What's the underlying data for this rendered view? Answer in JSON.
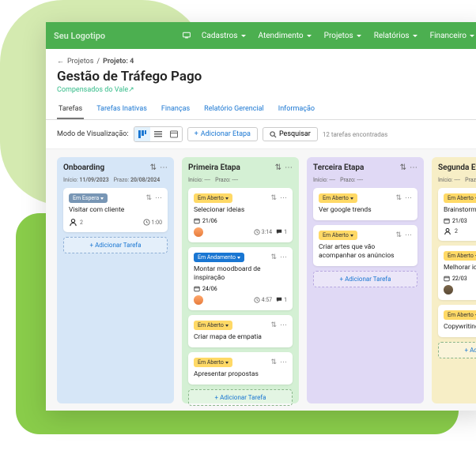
{
  "brand": {
    "logo": "Seu Logotipo"
  },
  "nav": {
    "items": [
      "Cadastros",
      "Atendimento",
      "Projetos",
      "Relatórios",
      "Financeiro"
    ]
  },
  "breadcrumb": {
    "back_icon": "←",
    "parent": "Projetos",
    "sep": "/",
    "current": "Projeto: 4"
  },
  "page": {
    "title": "Gestão de Tráfego Pago",
    "subtitle": "Compensados do Vale↗"
  },
  "tabs": [
    "Tarefas",
    "Tarefas Inativas",
    "Finanças",
    "Relatório Gerencial",
    "Informação"
  ],
  "toolbar": {
    "view_label": "Modo de Visualização:",
    "add_stage": "Adicionar Etapa",
    "search": "Pesquisar",
    "count": "12 tarefas encontradas"
  },
  "columns": [
    {
      "title": "Onboarding",
      "start_label": "Início:",
      "start": "11/09/2023",
      "end_label": "Prazo:",
      "end": "20/08/2024",
      "color": "blue",
      "cards": [
        {
          "status": "Em Espera",
          "status_kind": "espera",
          "title": "Visitar com cliente",
          "people": "2",
          "time": "1:00"
        }
      ],
      "add_label": "Adicionar Tarefa"
    },
    {
      "title": "Primeira Etapa",
      "start_label": "Início:",
      "start": "----",
      "end_label": "Prazo:",
      "end": "----",
      "color": "green",
      "cards": [
        {
          "status": "Em Aberto",
          "status_kind": "aberto",
          "title": "Selecionar ideias",
          "date": "21/06",
          "avatar": "u1",
          "time": "3:14",
          "comments": "1"
        },
        {
          "status": "Em Andamento",
          "status_kind": "andamento",
          "title": "Montar moodboard de inspiração",
          "date": "24/06",
          "avatar": "u1",
          "time": "4:57",
          "comments": "1"
        },
        {
          "status": "Em Aberto",
          "status_kind": "aberto",
          "title": "Criar mapa de empatia"
        },
        {
          "status": "Em Aberto",
          "status_kind": "aberto",
          "title": "Apresentar propostas"
        }
      ],
      "add_label": "Adicionar Tarefa"
    },
    {
      "title": "Terceira Etapa",
      "start_label": "Início:",
      "start": "----",
      "end_label": "Prazo:",
      "end": "----",
      "color": "purple",
      "cards": [
        {
          "status": "Em Aberto",
          "status_kind": "aberto",
          "title": "Ver google trends"
        },
        {
          "status": "Em Aberto",
          "status_kind": "aberto",
          "title": "Criar artes que vão acompanhar os anúncios"
        }
      ],
      "add_label": "Adicionar Tarefa"
    },
    {
      "title": "Segunda Etapa",
      "start_label": "Início:",
      "start": "----",
      "end_label": "Prazo:",
      "end": "----",
      "color": "yellow",
      "cards": [
        {
          "status": "Em Aberto",
          "status_kind": "aberto",
          "title": "Brainstorm Equipe",
          "date": "21/03",
          "people": "2"
        },
        {
          "status": "Em Aberto",
          "status_kind": "aberto",
          "title": "Melhorar ideia selecionada",
          "date": "22/03",
          "avatar": "u2"
        },
        {
          "status": "Em Aberto",
          "status_kind": "aberto",
          "title": "Copywriting"
        }
      ],
      "add_label": "Adicionar Tarefa"
    }
  ]
}
